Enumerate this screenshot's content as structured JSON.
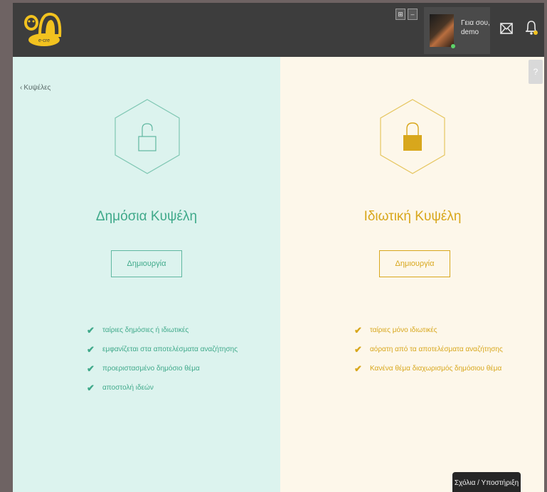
{
  "header": {
    "user_name_line1": "Γεια σου,",
    "user_name_line2": "demo",
    "widget_icons": [
      "layout-icon",
      "minimize-icon"
    ],
    "icons": [
      "logo-icon",
      "envelope-icon",
      "bell-icon"
    ]
  },
  "nav": {
    "back_label": "Κυψέλες",
    "help_label": "?"
  },
  "public": {
    "title": "Δημόσια Κυψέλη",
    "button": "Δημιουργία",
    "icon": "unlocked-padlock-icon",
    "accent": "#3fa98a",
    "features": [
      "ταίριες δημόσιες ή ιδιωτικές",
      "εμφανίζεται στα αποτελέσματα αναζήτησης",
      "προεριστασμένο δημόσιο θέμα",
      "αποστολή ιδεών"
    ]
  },
  "private": {
    "title": "Ιδιωτική Κυψέλη",
    "button": "Δημιουργία",
    "icon": "locked-padlock-icon",
    "accent": "#d8a71c",
    "features": [
      "ταίριες μόνο ιδιωτικές",
      "αόρατη από τα αποτελέσματα αναζήτησης",
      "Κανένα θέμα διαχωρισμός δημόσιου θέμα"
    ]
  },
  "support": {
    "label": "Σχόλια / Υποστήριξη"
  }
}
